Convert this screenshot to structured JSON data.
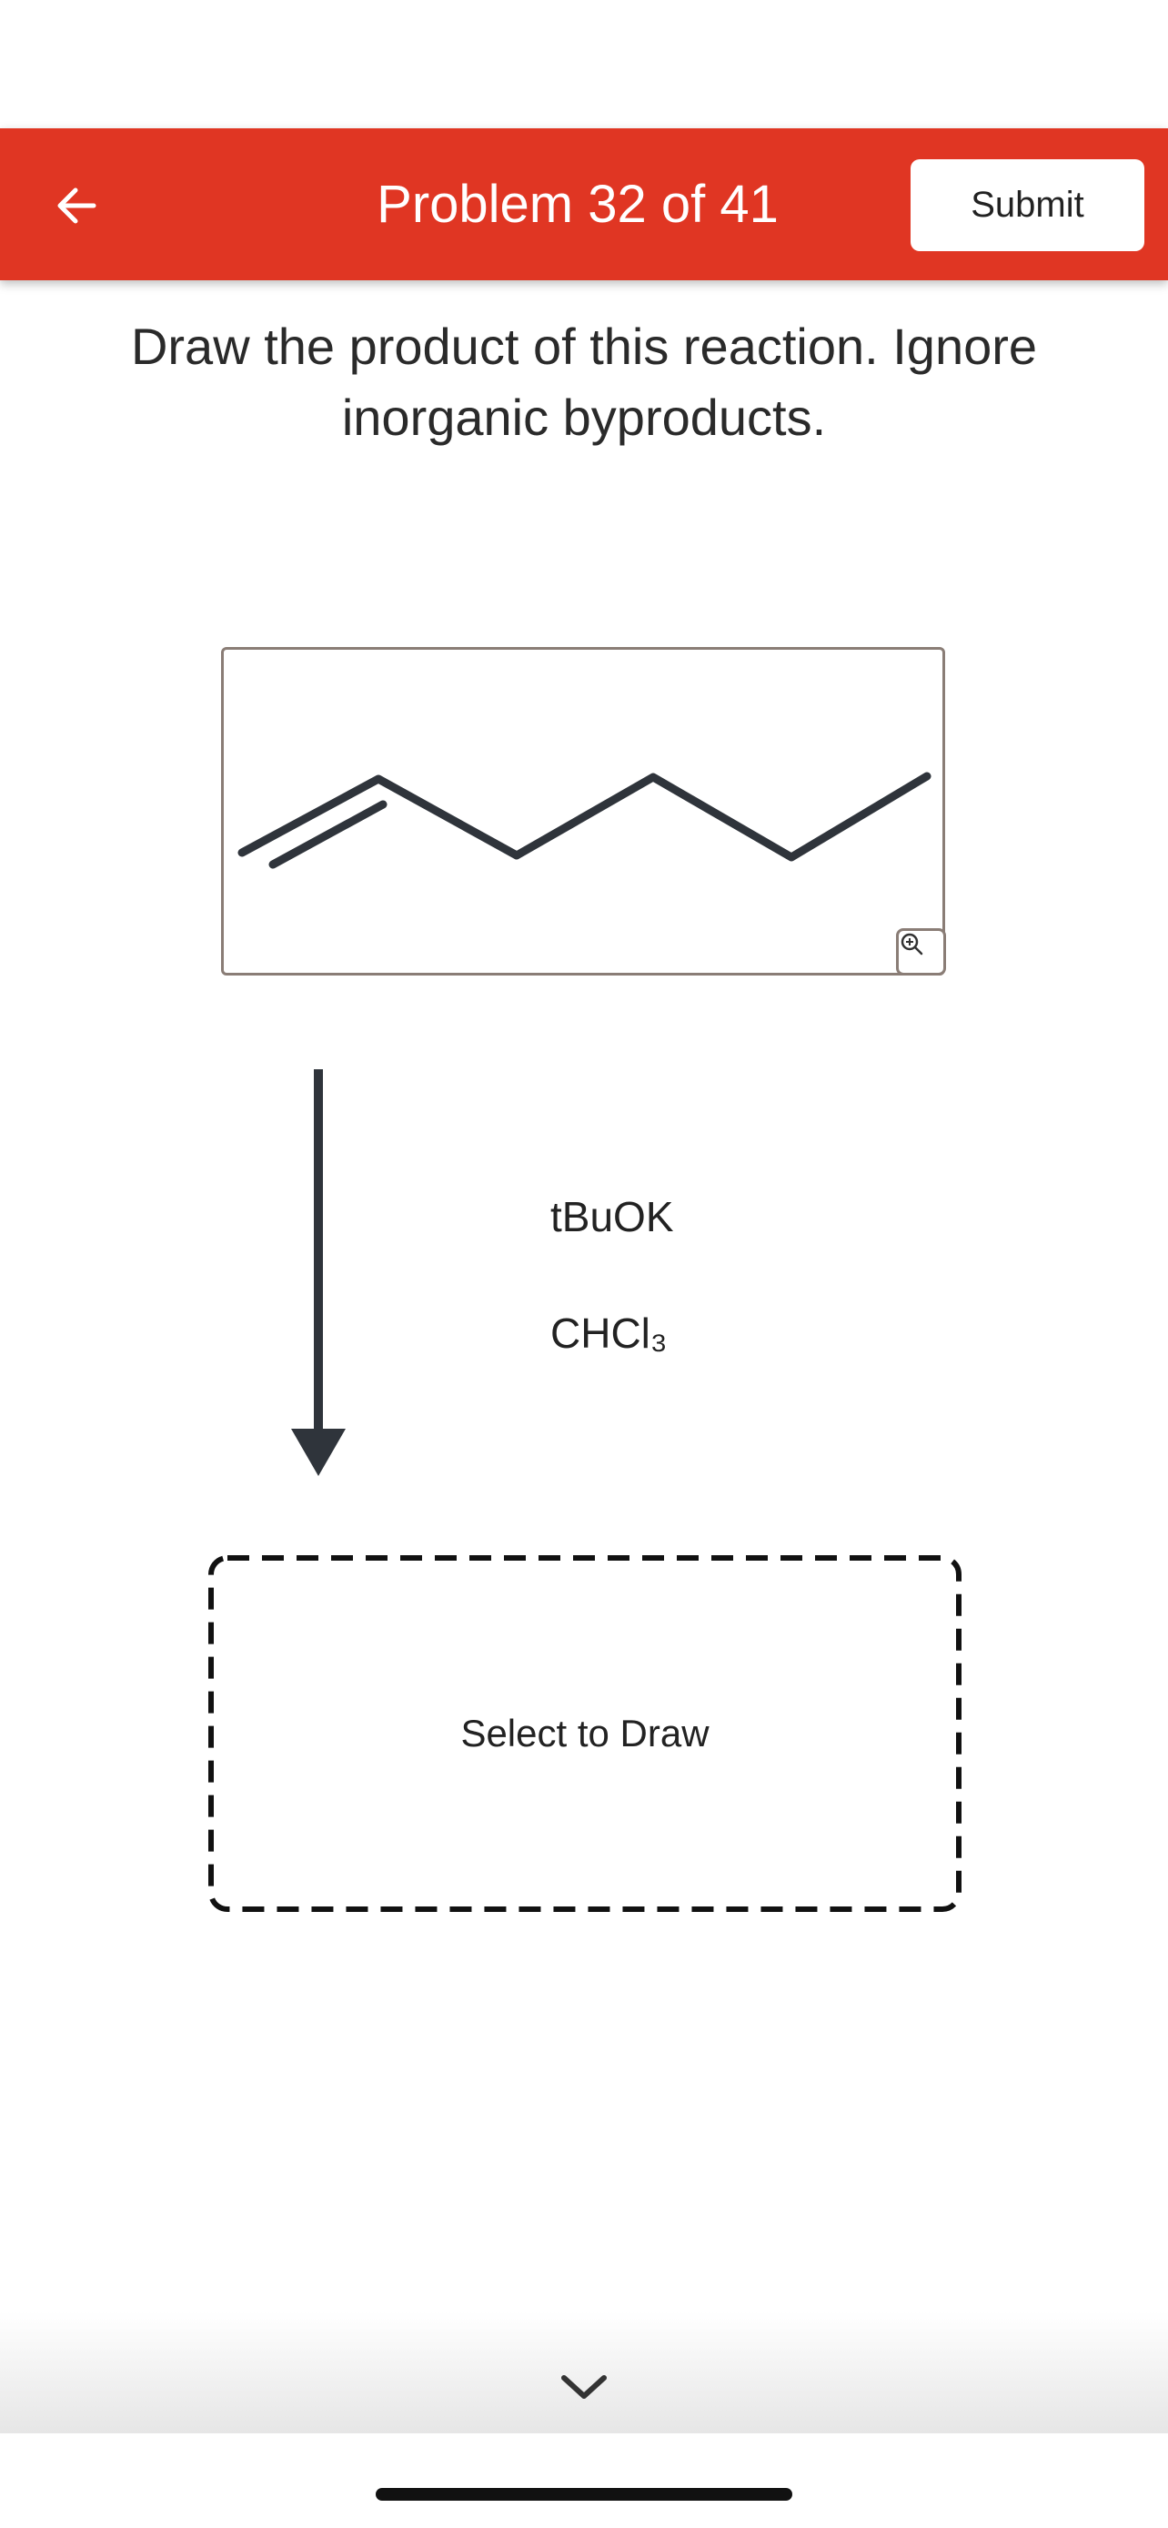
{
  "header": {
    "title": "Problem 32 of 41",
    "submit_label": "Submit",
    "back_icon": "arrow-left-icon",
    "color": "#e03623"
  },
  "question": {
    "text": "Draw the product of this reaction. Ignore inorganic byproducts."
  },
  "reactant": {
    "structure": "skeletal formula: terminal alkene (CH2=CH-CH2-CH2-CH2-CH3)",
    "zoom_icon": "zoom-in-icon"
  },
  "reaction": {
    "arrow_icon": "reaction-arrow-icon",
    "reagents": [
      "tBuOK",
      "CHCl₃"
    ]
  },
  "product": {
    "placeholder": "Select to Draw"
  },
  "footer": {
    "chevron_icon": "chevron-down-icon"
  }
}
